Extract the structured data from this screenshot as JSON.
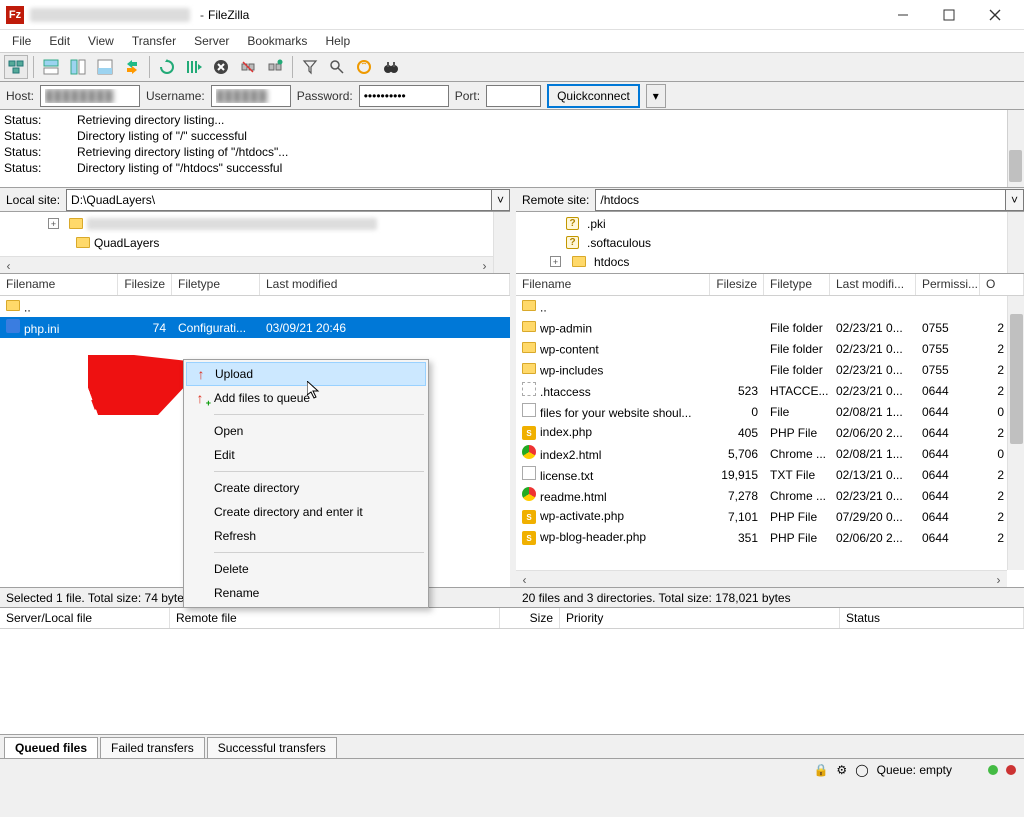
{
  "title": {
    "app_name": "FileZilla"
  },
  "menus": [
    "File",
    "Edit",
    "View",
    "Transfer",
    "Server",
    "Bookmarks",
    "Help"
  ],
  "quickconnect": {
    "host_label": "Host:",
    "user_label": "Username:",
    "pass_label": "Password:",
    "pass_value": "••••••••••",
    "port_label": "Port:",
    "button": "Quickconnect"
  },
  "status_log": [
    {
      "label": "Status:",
      "msg": "Retrieving directory listing..."
    },
    {
      "label": "Status:",
      "msg": "Directory listing of \"/\" successful"
    },
    {
      "label": "Status:",
      "msg": "Retrieving directory listing of \"/htdocs\"..."
    },
    {
      "label": "Status:",
      "msg": "Directory listing of \"/htdocs\" successful"
    }
  ],
  "local": {
    "site_label": "Local site:",
    "site_value": "D:\\QuadLayers\\",
    "tree": [
      {
        "name": "QuadLayers"
      }
    ],
    "columns": [
      "Filename",
      "Filesize",
      "Filetype",
      "Last modified"
    ],
    "rows": [
      {
        "icon": "folder",
        "name": "..",
        "size": "",
        "type": "",
        "mod": ""
      },
      {
        "icon": "ini",
        "name": "php.ini",
        "size": "74",
        "type": "Configurati...",
        "mod": "03/09/21 20:46",
        "selected": true
      }
    ],
    "status": "Selected 1 file. Total size: 74 bytes"
  },
  "remote": {
    "site_label": "Remote site:",
    "site_value": "/htdocs",
    "tree": [
      {
        "icon": "q",
        "name": ".pki"
      },
      {
        "icon": "q",
        "name": ".softaculous"
      },
      {
        "icon": "folder",
        "name": "htdocs",
        "expander": "+"
      }
    ],
    "columns": [
      "Filename",
      "Filesize",
      "Filetype",
      "Last modifi...",
      "Permissi...",
      "O"
    ],
    "rows": [
      {
        "icon": "folder",
        "name": "..",
        "size": "",
        "type": "",
        "mod": "",
        "perm": "",
        "o": ""
      },
      {
        "icon": "folder",
        "name": "wp-admin",
        "size": "",
        "type": "File folder",
        "mod": "02/23/21 0...",
        "perm": "0755",
        "o": "2"
      },
      {
        "icon": "folder",
        "name": "wp-content",
        "size": "",
        "type": "File folder",
        "mod": "02/23/21 0...",
        "perm": "0755",
        "o": "2"
      },
      {
        "icon": "folder",
        "name": "wp-includes",
        "size": "",
        "type": "File folder",
        "mod": "02/23/21 0...",
        "perm": "0755",
        "o": "2"
      },
      {
        "icon": "ht",
        "name": ".htaccess",
        "size": "523",
        "type": "HTACCE...",
        "mod": "02/23/21 0...",
        "perm": "0644",
        "o": "2"
      },
      {
        "icon": "blank",
        "name": "files for your website shoul...",
        "size": "0",
        "type": "File",
        "mod": "02/08/21 1...",
        "perm": "0644",
        "o": "0"
      },
      {
        "icon": "php",
        "name": "index.php",
        "size": "405",
        "type": "PHP File",
        "mod": "02/06/20 2...",
        "perm": "0644",
        "o": "2"
      },
      {
        "icon": "chrome",
        "name": "index2.html",
        "size": "5,706",
        "type": "Chrome ...",
        "mod": "02/08/21 1...",
        "perm": "0644",
        "o": "0"
      },
      {
        "icon": "txt",
        "name": "license.txt",
        "size": "19,915",
        "type": "TXT File",
        "mod": "02/13/21 0...",
        "perm": "0644",
        "o": "2"
      },
      {
        "icon": "chrome",
        "name": "readme.html",
        "size": "7,278",
        "type": "Chrome ...",
        "mod": "02/23/21 0...",
        "perm": "0644",
        "o": "2"
      },
      {
        "icon": "php",
        "name": "wp-activate.php",
        "size": "7,101",
        "type": "PHP File",
        "mod": "07/29/20 0...",
        "perm": "0644",
        "o": "2"
      },
      {
        "icon": "php",
        "name": "wp-blog-header.php",
        "size": "351",
        "type": "PHP File",
        "mod": "02/06/20 2...",
        "perm": "0644",
        "o": "2"
      }
    ],
    "status": "20 files and 3 directories. Total size: 178,021 bytes"
  },
  "context_menu": {
    "items": [
      {
        "label": "Upload",
        "icon": "up",
        "hl": true
      },
      {
        "label": "Add files to queue",
        "icon": "up-plus"
      },
      {
        "sep": true
      },
      {
        "label": "Open"
      },
      {
        "label": "Edit"
      },
      {
        "sep": true
      },
      {
        "label": "Create directory"
      },
      {
        "label": "Create directory and enter it"
      },
      {
        "label": "Refresh"
      },
      {
        "sep": true
      },
      {
        "label": "Delete"
      },
      {
        "label": "Rename"
      }
    ]
  },
  "queue": {
    "columns": [
      "Server/Local file",
      "Remote file",
      "Size",
      "Priority",
      "Status"
    ],
    "tabs": [
      "Queued files",
      "Failed transfers",
      "Successful transfers"
    ],
    "active_tab": 0
  },
  "footer": {
    "queue_text": "Queue: empty"
  }
}
